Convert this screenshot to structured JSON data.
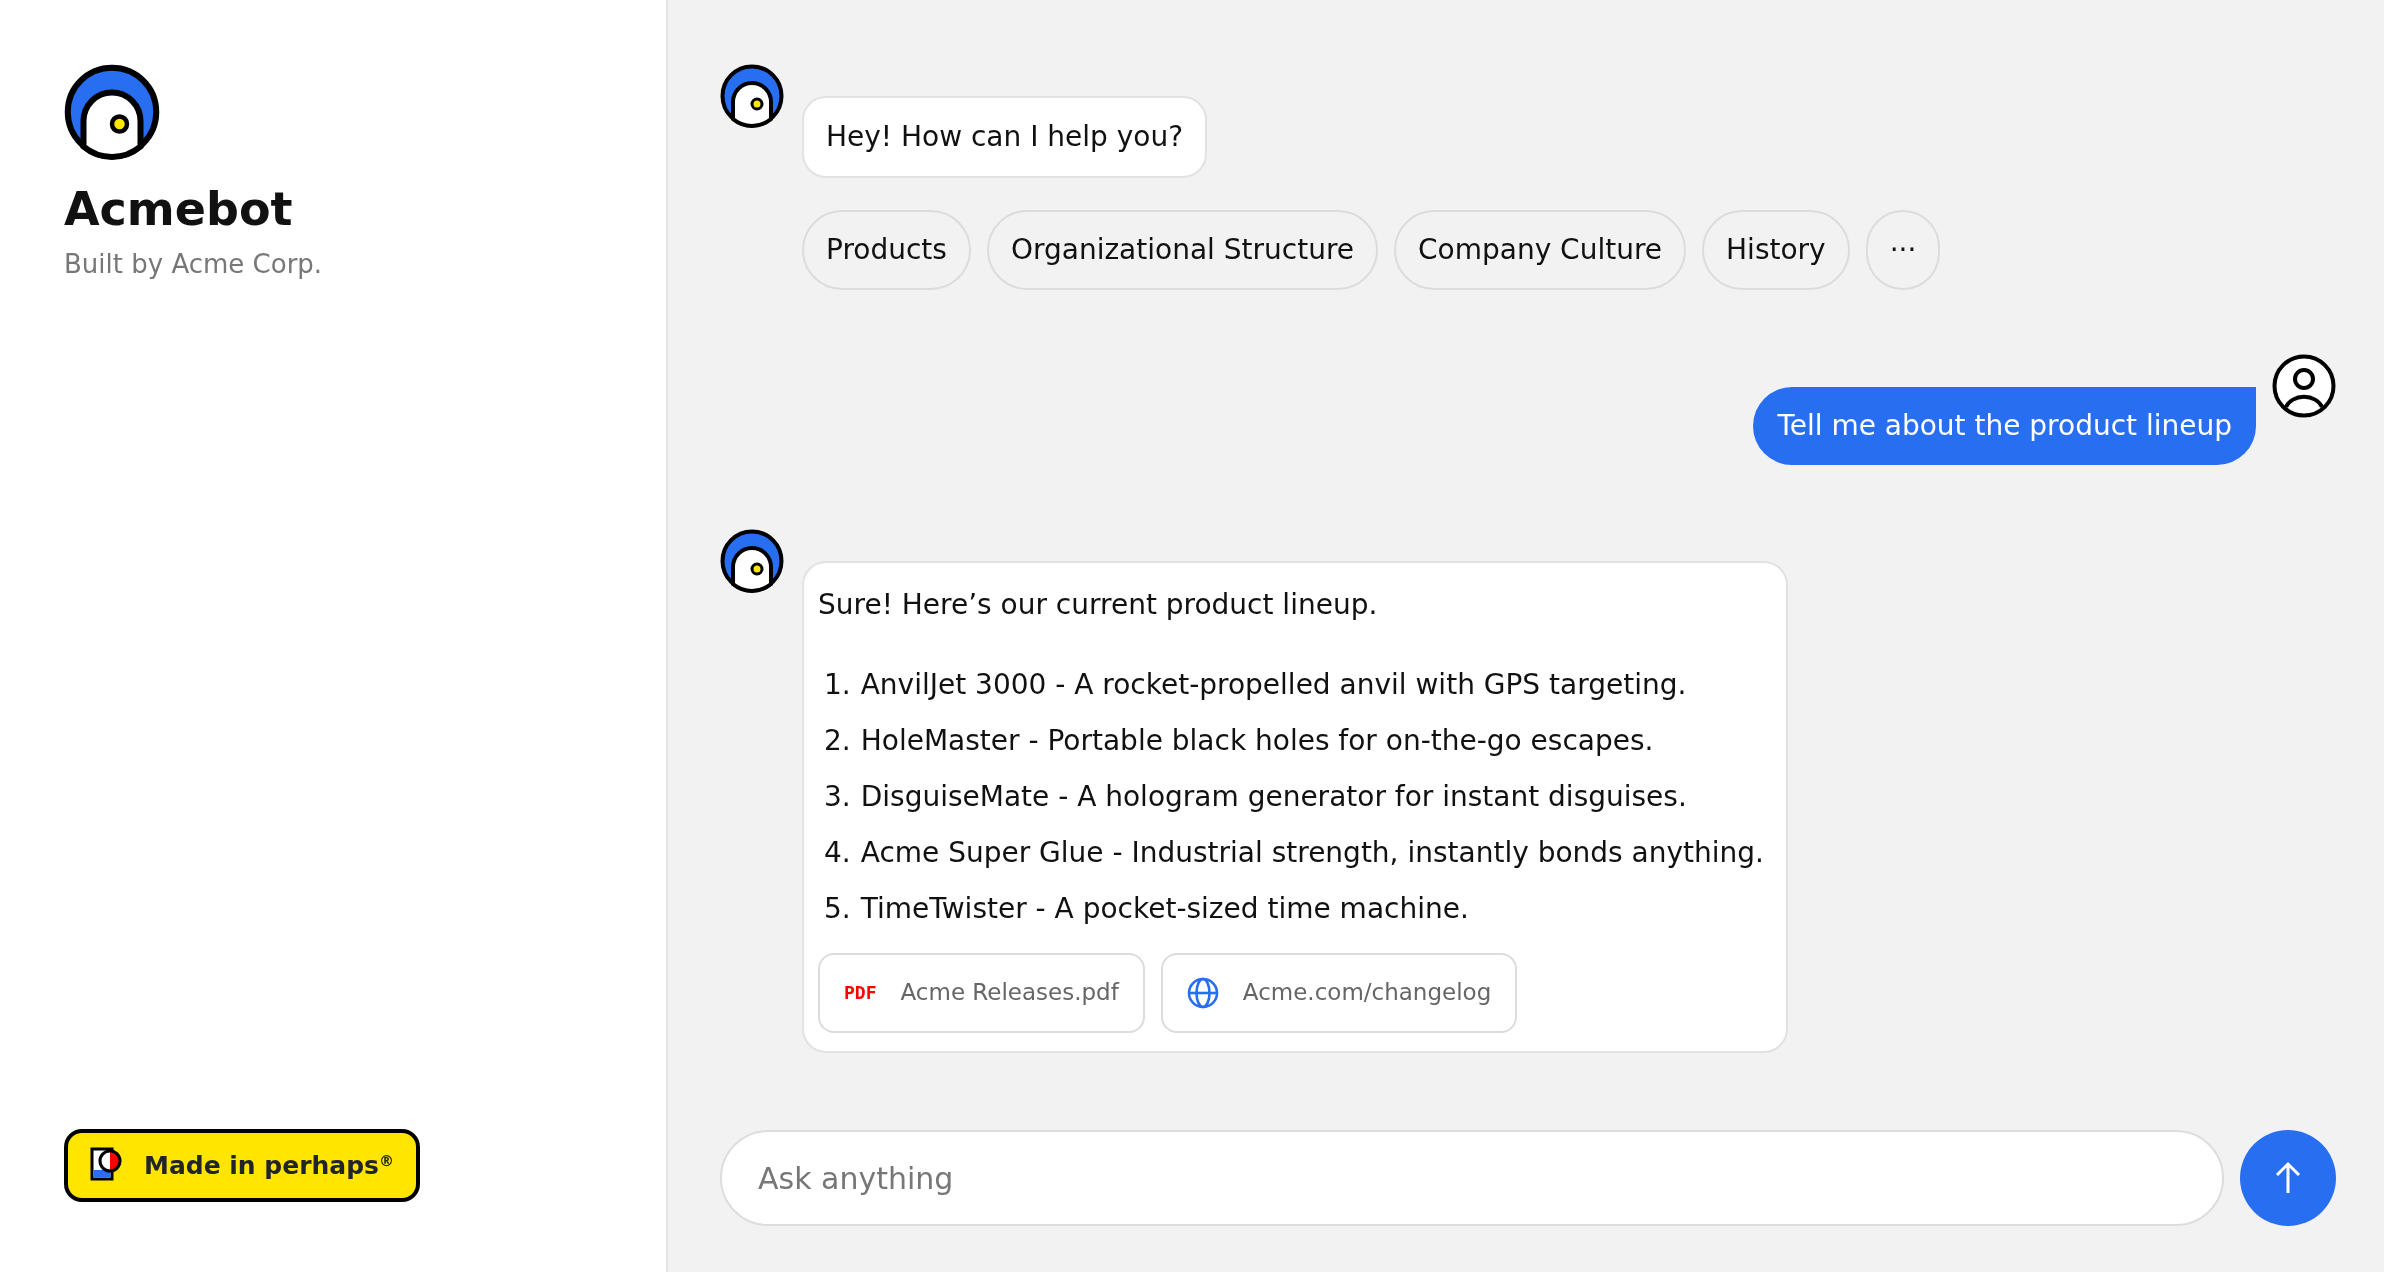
{
  "sidebar": {
    "title": "Acmebot",
    "subtitle": "Built by Acme Corp.",
    "badge": "Made in perhaps$^{®}$"
  },
  "messages": [
    {
      "kind": "bot",
      "text": "Hey! How can I help you?",
      "suggestions": [
        "Products",
        "Organizational Structure",
        "Company Culture",
        "History",
        "···"
      ]
    },
    {
      "kind": "user",
      "text": "Tell me about the product lineup"
    },
    {
      "kind": "bot",
      "text": "Sure! Here’s our current product lineup.",
      "list": [
        {
          "number": "1.",
          "text": "AnvilJet 3000 - A rocket-propelled anvil with GPS targeting."
        },
        {
          "number": "2.",
          "text": "HoleMaster - Portable black holes for on-the-go escapes."
        },
        {
          "number": "3.",
          "text": "DisguiseMate - A hologram generator for instant disguises."
        },
        {
          "number": "4.",
          "text": "Acme Super Glue - Industrial strength, instantly bonds anything."
        },
        {
          "number": "5.",
          "text": "TimeTwister - A pocket-sized time machine."
        }
      ],
      "attachments": [
        {
          "kind": "pdf",
          "icon_text": "PDF",
          "label": "Acme Releases.pdf"
        },
        {
          "kind": "web",
          "label": "Acme.com/changelog"
        }
      ]
    }
  ],
  "composer": {
    "placeholder": "Ask anything"
  }
}
